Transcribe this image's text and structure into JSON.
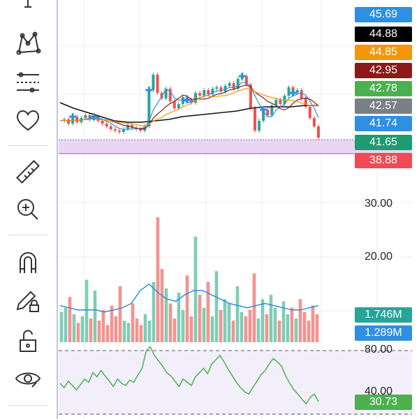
{
  "toolbar": {
    "tools": [
      {
        "name": "cursor-line-tool",
        "icon": "line-cursor-icon"
      },
      {
        "name": "pattern-tool",
        "icon": "xabcd-pattern-icon"
      },
      {
        "name": "indicators-tool",
        "icon": "fib-levels-icon"
      },
      {
        "name": "favorites-tool",
        "icon": "heart-icon"
      },
      {
        "name": "measure-tool",
        "icon": "ruler-icon"
      },
      {
        "name": "zoom-tool",
        "icon": "zoom-in-icon"
      },
      {
        "name": "magnet-tool",
        "icon": "magnet-icon"
      },
      {
        "name": "lock-drawing-tool",
        "icon": "pencil-lock-icon"
      },
      {
        "name": "unlock-tool",
        "icon": "unlock-icon"
      },
      {
        "name": "visibility-tool",
        "icon": "eye-icon"
      }
    ]
  },
  "price_tags": [
    {
      "label": "45.69",
      "color": "#2f8fe0"
    },
    {
      "label": "44.88",
      "color": "#000000"
    },
    {
      "label": "44.85",
      "color": "#f5960a"
    },
    {
      "label": "42.95",
      "color": "#8b1a1a"
    },
    {
      "label": "42.78",
      "color": "#4caf50"
    },
    {
      "label": "42.57",
      "color": "#7b7f86"
    },
    {
      "label": "41.74",
      "color": "#2f8fe0"
    },
    {
      "label": "41.65",
      "color": "#1f9b72"
    },
    {
      "label": "38.88",
      "color": "#ef4b54"
    }
  ],
  "volume_axis": {
    "labels": [
      "30.00",
      "20.00"
    ]
  },
  "volume_tags": [
    {
      "label": "1.746M",
      "color": "#26a69a"
    },
    {
      "label": "1.289M",
      "color": "#2f8fe0"
    }
  ],
  "rsi_axis": {
    "labels": [
      "80.00",
      "40.00"
    ]
  },
  "rsi_tag": {
    "label": "30.73",
    "color": "#4caf50"
  },
  "chart_data": [
    {
      "type": "line",
      "panel": "price",
      "close": [
        41.6,
        41.7,
        41.4,
        41.9,
        41.5,
        41.8,
        42.0,
        41.7,
        41.9,
        41.6,
        41.4,
        41.2,
        41.0,
        40.9,
        40.8,
        41.0,
        41.3,
        41.1,
        41.0,
        40.9,
        41.2,
        43.8,
        44.9,
        43.6,
        43.2,
        43.9,
        43.0,
        42.5,
        42.8,
        43.3,
        43.1,
        42.9,
        43.6,
        43.4,
        43.8,
        43.5,
        43.9,
        44.0,
        43.7,
        44.1,
        44.3,
        43.9,
        44.6,
        44.8,
        44.2,
        42.5,
        40.9,
        41.6,
        42.4,
        42.0,
        42.7,
        43.1,
        42.8,
        43.4,
        44.0,
        43.6,
        43.8,
        43.2,
        42.6,
        41.8,
        41.2,
        40.4
      ],
      "sma_long": [
        42.9,
        42.5,
        42.2,
        41.9,
        41.6,
        41.5,
        41.5,
        41.6,
        41.7,
        41.9,
        42.0,
        42.1,
        42.2,
        42.3,
        42.5,
        42.6,
        42.6,
        42.6,
        42.7,
        42.7
      ],
      "ylim": [
        40,
        47
      ]
    },
    {
      "type": "bar",
      "panel": "volume",
      "values": [
        1.4,
        1.6,
        2.1,
        1.3,
        0.9,
        1.2,
        2.9,
        1.1,
        2.4,
        1.0,
        1.5,
        0.8,
        1.7,
        1.2,
        2.6,
        1.0,
        0.9,
        1.8,
        1.1,
        0.8,
        1.3,
        1.0,
        2.8,
        5.8,
        3.4,
        2.5,
        1.8,
        1.1,
        2.3,
        1.5,
        3.1,
        1.2,
        4.9,
        2.2,
        1.6,
        2.8,
        1.2,
        3.3,
        1.5,
        2.0,
        1.8,
        1.0,
        2.6,
        1.4,
        1.2,
        1.5,
        3.2,
        1.1,
        2.0,
        1.3,
        2.2,
        1.6,
        1.0,
        1.9,
        1.3,
        1.6,
        1.1,
        2.0,
        1.4,
        1.0,
        1.7,
        1.3
      ],
      "ma": [
        1.7,
        1.6,
        1.5,
        1.5,
        1.5,
        1.4,
        1.5,
        1.6,
        1.8,
        2.4,
        2.7,
        2.3,
        2.0,
        1.9,
        2.2,
        2.4,
        2.4,
        2.2,
        2.0,
        1.8,
        1.7,
        1.6,
        1.7,
        1.8,
        1.7,
        1.6,
        1.5,
        1.5,
        1.6,
        1.7
      ],
      "y_ticks": [
        "30.00",
        "20.00"
      ],
      "ylim": [
        0,
        6.0
      ]
    },
    {
      "type": "line",
      "panel": "rsi",
      "values": [
        48,
        44,
        50,
        46,
        42,
        47,
        52,
        49,
        58,
        54,
        60,
        55,
        50,
        45,
        52,
        48,
        46,
        51,
        49,
        56,
        62,
        78,
        82,
        74,
        69,
        64,
        58,
        55,
        50,
        45,
        52,
        49,
        46,
        54,
        58,
        62,
        57,
        66,
        70,
        74,
        68,
        61,
        55,
        49,
        44,
        40,
        38,
        44,
        50,
        56,
        60,
        66,
        71,
        68,
        64,
        55,
        48,
        42,
        38,
        33,
        29,
        35,
        38,
        31
      ],
      "y_ticks": [
        "80.00",
        "40.00"
      ],
      "ylim": [
        20,
        85
      ]
    }
  ]
}
